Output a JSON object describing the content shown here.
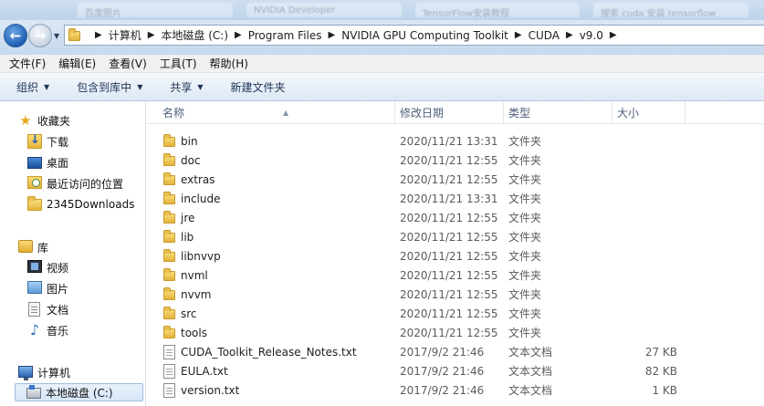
{
  "tabs_strip": {
    "ghost_tabs": [
      "百度图片",
      "NVIDIA Developer",
      "TensorFlow安装教程",
      "搜索 cuda 安装 tensorflow"
    ]
  },
  "address": {
    "breadcrumbs": [
      "计算机",
      "本地磁盘 (C:)",
      "Program Files",
      "NVIDIA GPU Computing Toolkit",
      "CUDA",
      "v9.0"
    ],
    "separator": "▶"
  },
  "menubar": {
    "items": [
      "文件(F)",
      "编辑(E)",
      "查看(V)",
      "工具(T)",
      "帮助(H)"
    ]
  },
  "cmdbar": {
    "items": [
      {
        "label": "组织",
        "dropdown": true
      },
      {
        "label": "包含到库中",
        "dropdown": true
      },
      {
        "label": "共享",
        "dropdown": true
      },
      {
        "label": "新建文件夹",
        "dropdown": false
      }
    ]
  },
  "navpane": {
    "favorites": "收藏夹",
    "downloads": "下载",
    "desktop": "桌面",
    "recent": "最近访问的位置",
    "downloads2345": "2345Downloads",
    "libraries": "库",
    "videos": "视频",
    "pictures": "图片",
    "documents": "文档",
    "music": "音乐",
    "computer": "计算机",
    "local_disk": "本地磁盘 (C:)"
  },
  "columns": {
    "name": "名称",
    "date": "修改日期",
    "type": "类型",
    "size": "大小"
  },
  "files": [
    {
      "name": "bin",
      "date": "2020/11/21 13:31",
      "type": "文件夹",
      "size": "",
      "kind": "folder"
    },
    {
      "name": "doc",
      "date": "2020/11/21 12:55",
      "type": "文件夹",
      "size": "",
      "kind": "folder"
    },
    {
      "name": "extras",
      "date": "2020/11/21 12:55",
      "type": "文件夹",
      "size": "",
      "kind": "folder"
    },
    {
      "name": "include",
      "date": "2020/11/21 13:31",
      "type": "文件夹",
      "size": "",
      "kind": "folder"
    },
    {
      "name": "jre",
      "date": "2020/11/21 12:55",
      "type": "文件夹",
      "size": "",
      "kind": "folder"
    },
    {
      "name": "lib",
      "date": "2020/11/21 12:55",
      "type": "文件夹",
      "size": "",
      "kind": "folder"
    },
    {
      "name": "libnvvp",
      "date": "2020/11/21 12:55",
      "type": "文件夹",
      "size": "",
      "kind": "folder"
    },
    {
      "name": "nvml",
      "date": "2020/11/21 12:55",
      "type": "文件夹",
      "size": "",
      "kind": "folder"
    },
    {
      "name": "nvvm",
      "date": "2020/11/21 12:55",
      "type": "文件夹",
      "size": "",
      "kind": "folder"
    },
    {
      "name": "src",
      "date": "2020/11/21 12:55",
      "type": "文件夹",
      "size": "",
      "kind": "folder"
    },
    {
      "name": "tools",
      "date": "2020/11/21 12:55",
      "type": "文件夹",
      "size": "",
      "kind": "folder"
    },
    {
      "name": "CUDA_Toolkit_Release_Notes.txt",
      "date": "2017/9/2 21:46",
      "type": "文本文档",
      "size": "27 KB",
      "kind": "text"
    },
    {
      "name": "EULA.txt",
      "date": "2017/9/2 21:46",
      "type": "文本文档",
      "size": "82 KB",
      "kind": "text"
    },
    {
      "name": "version.txt",
      "date": "2017/9/2 21:46",
      "type": "文本文档",
      "size": "1 KB",
      "kind": "text"
    }
  ]
}
